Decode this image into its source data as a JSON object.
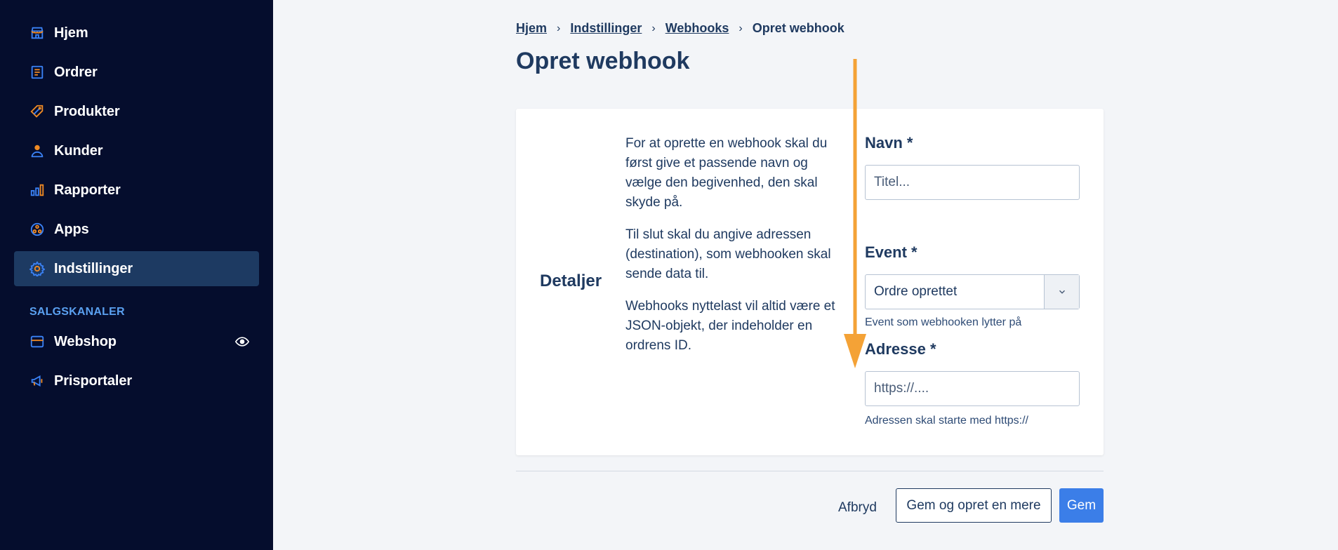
{
  "sidebar": {
    "items": [
      {
        "label": "Hjem",
        "icon": "home-icon"
      },
      {
        "label": "Ordrer",
        "icon": "orders-icon"
      },
      {
        "label": "Produkter",
        "icon": "tag-icon"
      },
      {
        "label": "Kunder",
        "icon": "user-icon"
      },
      {
        "label": "Rapporter",
        "icon": "bar-chart-icon"
      },
      {
        "label": "Apps",
        "icon": "apps-icon"
      },
      {
        "label": "Indstillinger",
        "icon": "gear-icon",
        "active": true
      }
    ],
    "section_label": "SALGSKANALER",
    "channels": [
      {
        "label": "Webshop",
        "icon": "storefront-icon",
        "trailing_icon": "eye-icon"
      },
      {
        "label": "Prisportaler",
        "icon": "megaphone-icon"
      }
    ]
  },
  "breadcrumb": {
    "items": [
      "Hjem",
      "Indstillinger",
      "Webhooks"
    ],
    "current": "Opret webhook"
  },
  "page": {
    "title": "Opret webhook"
  },
  "card": {
    "heading": "Detaljer",
    "description": [
      "For at oprette en webhook skal du først give et passende navn og vælge den begivenhed, den skal skyde på.",
      "Til slut skal du angive adressen (destination), som webhooken skal sende data til.",
      "Webhooks nyttelast vil altid være et JSON-objekt, der indeholder en ordrens ID."
    ],
    "fields": {
      "name": {
        "label": "Navn *",
        "placeholder": "Titel..."
      },
      "event": {
        "label": "Event *",
        "value": "Ordre oprettet",
        "hint": "Event som webhooken lytter på"
      },
      "address": {
        "label": "Adresse *",
        "placeholder": "https://....",
        "hint": "Adressen skal starte med https://"
      }
    }
  },
  "actions": {
    "cancel": "Afbryd",
    "save_and_new": "Gem og opret en mere",
    "save": "Gem"
  },
  "colors": {
    "sidebar_bg": "#050d2d",
    "sidebar_active": "#1d3a62",
    "icon_accent": "#3b82f6",
    "icon_orange": "#f08a24",
    "primary": "#3b7ee8",
    "text": "#1f3a60",
    "annotation_arrow": "#f4a236"
  }
}
